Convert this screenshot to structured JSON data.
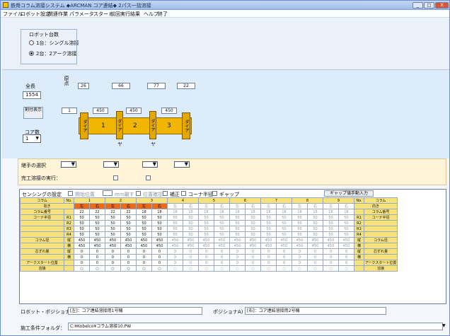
{
  "window": {
    "title": "鉄骨コラム溶接システム ◆ARCMAN コア連結◆ 2パス一括溶接",
    "min": "_",
    "max": "□",
    "close": "X"
  },
  "menu": [
    "ファイル",
    "ロボット設定",
    "関連作業",
    "パラメータ",
    "スタート",
    "前回実行結果",
    "ヘルプ",
    "終了"
  ],
  "robot": {
    "title": "ロボット台数",
    "opt1": "1台：シングル溶接",
    "opt2": "2台：2アーク溶接"
  },
  "dims": {
    "total_label": "全長",
    "total_value": "1554",
    "origin_label": "原点",
    "pitch_label": "割付表示",
    "core_label": "コア数",
    "core_value": "1",
    "top": [
      "26",
      "66",
      "77",
      "22"
    ],
    "mid": [
      "1",
      "450",
      "450",
      "450"
    ],
    "col_labels": [
      "1",
      "2",
      "3"
    ],
    "vert_labels": [
      "ダイア",
      "ダイア",
      "ダイア",
      "ダイア"
    ],
    "pin_labels": [
      "ヤ",
      "ヤ"
    ]
  },
  "sel": {
    "row1": "継手の選択",
    "row2": "完工溶接の実行："
  },
  "sensing": {
    "label": "センシングの設定",
    "opt1": "開始位置",
    "opt2": "mm離す",
    "opt3": "位置確認",
    "opt4": "補正",
    "opt5": "コーナ半径",
    "opt6": "ギャップ",
    "btn": "ギャップ値手動入力"
  },
  "table": {
    "header_left": [
      "コラム",
      "向き"
    ],
    "nums": [
      "1",
      "2",
      "3",
      "4",
      "5",
      "6",
      "7",
      "8",
      "9"
    ],
    "sides": [
      "左",
      "右"
    ],
    "rows": [
      {
        "name": "コラム番号",
        "vals": [
          "22",
          "22",
          "18",
          "18",
          "18",
          "18",
          "18",
          "18",
          "18"
        ]
      },
      {
        "name": "コーナ半径",
        "sub": "R1",
        "vals": [
          "50",
          "50",
          "50",
          "50",
          "50",
          "50",
          "50",
          "50",
          "50"
        ]
      },
      {
        "name": "",
        "sub": "R2",
        "vals": [
          "50",
          "50",
          "50",
          "50",
          "50",
          "50",
          "50",
          "50",
          "50"
        ]
      },
      {
        "name": "",
        "sub": "R3",
        "vals": [
          "50",
          "50",
          "50",
          "50",
          "50",
          "50",
          "50",
          "50",
          "50"
        ]
      },
      {
        "name": "",
        "sub": "R4",
        "vals": [
          "50",
          "50",
          "50",
          "50",
          "50",
          "50",
          "50",
          "50",
          "50"
        ]
      },
      {
        "name": "コラム径",
        "sub": "縦",
        "vals": [
          "450",
          "450",
          "450",
          "450",
          "450",
          "450",
          "450",
          "450",
          "450"
        ]
      },
      {
        "name": "",
        "sub": "横",
        "vals": [
          "450",
          "450",
          "450",
          "450",
          "450",
          "450",
          "450",
          "450",
          "450"
        ]
      },
      {
        "name": "芯ずれ量",
        "sub": "縦",
        "vals": [
          "0",
          "0",
          "0",
          "0",
          "0",
          "0",
          "0",
          "0",
          "0"
        ]
      },
      {
        "name": "",
        "sub": "横",
        "vals": [
          "0",
          "0",
          "0",
          "0",
          "0",
          "0",
          "0",
          "0",
          "0"
        ]
      },
      {
        "name": "アークスタート位置",
        "sub": "",
        "vals": [
          "0",
          "0",
          "0",
          "0",
          "0",
          "0",
          "0",
          "0",
          "0"
        ]
      },
      {
        "name": "溶接",
        "sub": "",
        "vals": [
          "○",
          "○",
          "○",
          "○",
          "○",
          "○",
          "○",
          "○",
          "○"
        ]
      }
    ],
    "right_head": [
      "No.",
      "コラム",
      "向き"
    ],
    "right_labels": [
      "コラム番号",
      "コーナ半径",
      "コラム径",
      "芯ずれ量",
      "アークスタート位置",
      "溶接"
    ]
  },
  "bottom": {
    "robot_pos_label": "ロボット・ポジショナ：",
    "robot_pos_value": "[左]：コア連結溶接用1号機",
    "positioner_label": "ポジショナA)",
    "positioner_value": "[右]：コア連結溶接用2号機",
    "folder_label": "施工条件フォルダ：",
    "folder_value": "C:¥Kobelco¥コラム溶接10.PW"
  }
}
